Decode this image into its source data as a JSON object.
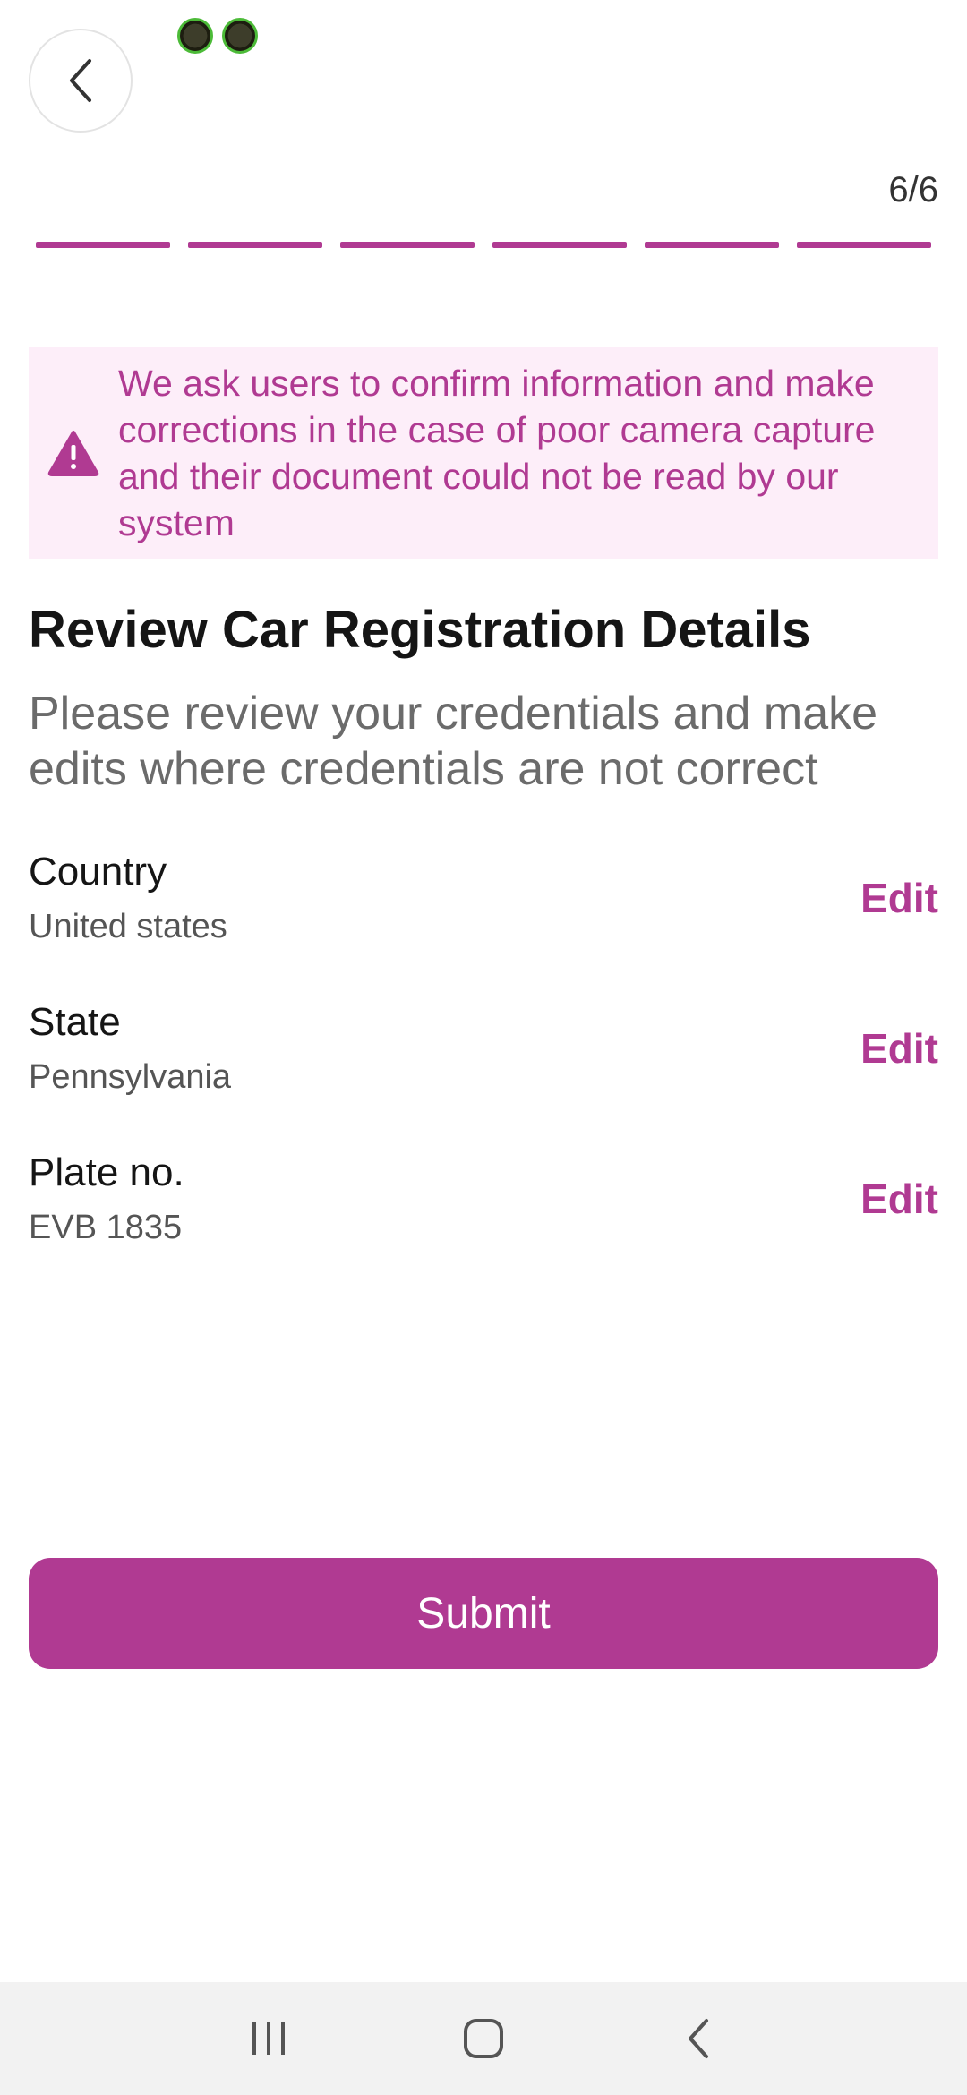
{
  "header": {
    "step_counter": "6/6",
    "progress_total": 6,
    "progress_completed": 6
  },
  "warning": {
    "text": "We ask users to confirm information and make corrections in the case of poor camera capture and their document could not be read by our system"
  },
  "page": {
    "title": "Review Car Registration Details",
    "subtitle": "Please review your credentials and make edits where credentials are not correct"
  },
  "details": [
    {
      "label": "Country",
      "value": "United states",
      "action": "Edit"
    },
    {
      "label": "State",
      "value": "Pennsylvania",
      "action": "Edit"
    },
    {
      "label": "Plate no.",
      "value": "EVB 1835",
      "action": "Edit"
    }
  ],
  "actions": {
    "submit_label": "Submit"
  },
  "icons": {
    "back": "chevron-left-icon",
    "warning": "warning-triangle-icon",
    "nav_recents": "recents-icon",
    "nav_home": "home-icon",
    "nav_back": "nav-back-icon"
  },
  "colors": {
    "accent": "#b03a92",
    "warning_bg": "#fdeef9",
    "nav_bg": "#f2f2f2"
  }
}
